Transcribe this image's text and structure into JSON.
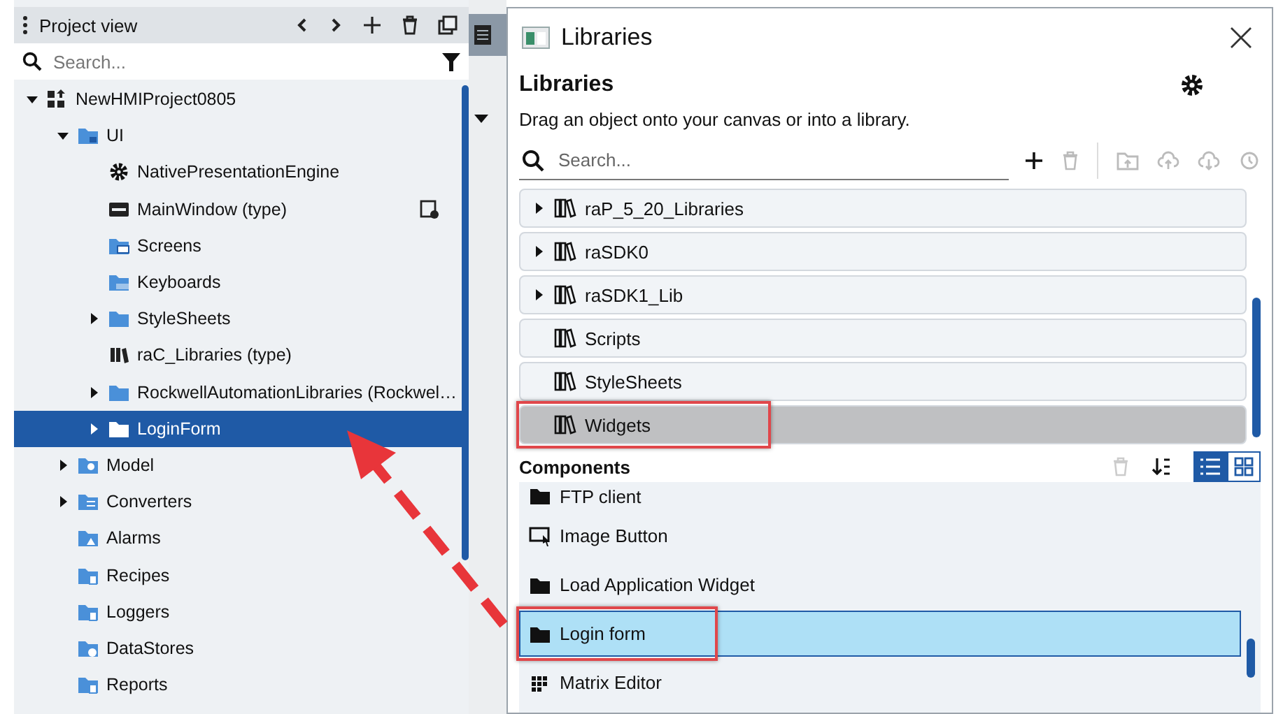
{
  "project_view": {
    "title": "Project view",
    "search": {
      "placeholder": "Search..."
    },
    "tree": [
      {
        "label": "NewHMIProject0805",
        "kind": "project",
        "expanded": true,
        "selected": false,
        "children": [
          {
            "label": "UI",
            "kind": "ui",
            "expanded": true,
            "selected": false,
            "children": [
              {
                "label": "NativePresentationEngine",
                "kind": "engine",
                "selected": false
              },
              {
                "label": "MainWindow (type)",
                "kind": "window",
                "selected": false,
                "badge": true
              },
              {
                "label": "Screens",
                "kind": "screens",
                "selected": false
              },
              {
                "label": "Keyboards",
                "kind": "keyboards",
                "selected": false
              },
              {
                "label": "StyleSheets",
                "kind": "folder",
                "expanded": false,
                "selected": false
              },
              {
                "label": "raC_Libraries (type)",
                "kind": "library-type",
                "selected": false
              },
              {
                "label": "RockwellAutomationLibraries (Rockwel…",
                "kind": "folder",
                "expanded": false,
                "selected": false
              },
              {
                "label": "LoginForm",
                "kind": "folder",
                "expanded": false,
                "selected": true
              }
            ]
          },
          {
            "label": "Model",
            "kind": "model",
            "expanded": false,
            "selected": false
          },
          {
            "label": "Converters",
            "kind": "converters",
            "expanded": false,
            "selected": false
          },
          {
            "label": "Alarms",
            "kind": "alarms",
            "selected": false
          },
          {
            "label": "Recipes",
            "kind": "recipes",
            "selected": false
          },
          {
            "label": "Loggers",
            "kind": "loggers",
            "selected": false
          },
          {
            "label": "DataStores",
            "kind": "datastores",
            "selected": false
          },
          {
            "label": "Reports",
            "kind": "reports",
            "selected": false
          }
        ]
      }
    ]
  },
  "dialog": {
    "title": "Libraries",
    "heading": "Libraries",
    "hint": "Drag an object onto your canvas or into a library.",
    "search": {
      "placeholder": "Search..."
    },
    "libraries": [
      {
        "label": "raP_5_20_Libraries",
        "expanded": false,
        "selected": false
      },
      {
        "label": "raSDK0",
        "expanded": false,
        "selected": false
      },
      {
        "label": "raSDK1_Lib",
        "expanded": false,
        "selected": false
      },
      {
        "label": "Scripts",
        "selected": false
      },
      {
        "label": "StyleSheets",
        "selected": false
      },
      {
        "label": "Widgets",
        "selected": true,
        "highlighted": true
      }
    ],
    "components_title": "Components",
    "views": [
      {
        "kind": "list",
        "selected": true
      },
      {
        "kind": "grid",
        "selected": false
      }
    ],
    "components": [
      {
        "label": "FTP client",
        "kind": "folder",
        "selected": false
      },
      {
        "label": "Image Button",
        "kind": "image-button",
        "selected": false
      },
      {
        "label": "Load Application Widget",
        "kind": "folder",
        "selected": false
      },
      {
        "label": "Login form",
        "kind": "folder",
        "selected": true,
        "highlighted": true
      },
      {
        "label": "Matrix Editor",
        "kind": "matrix",
        "selected": false
      }
    ]
  }
}
